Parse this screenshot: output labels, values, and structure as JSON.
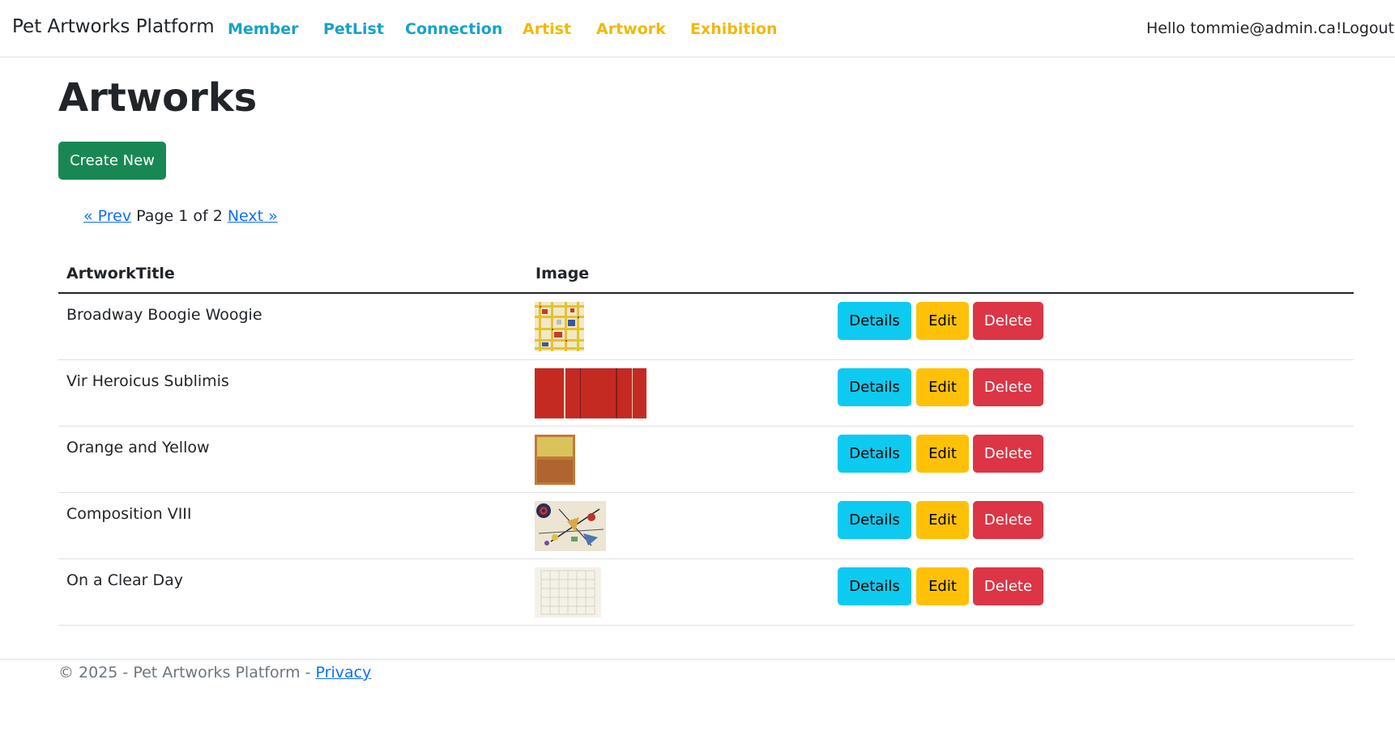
{
  "nav": {
    "brand": "Pet Artworks Platform",
    "links": [
      {
        "label": "Member",
        "color": "#17a2c8"
      },
      {
        "label": "PetList",
        "color": "#17a2c8"
      },
      {
        "label": "Connection",
        "color": "#17a2c8"
      },
      {
        "label": "Artist",
        "color": "#f0b90b"
      },
      {
        "label": "Artwork",
        "color": "#f0b90b"
      },
      {
        "label": "Exhibition",
        "color": "#f0b90b"
      }
    ],
    "greeting": "Hello tommie@admin.ca!",
    "logout": "Logout"
  },
  "page": {
    "title": "Artworks",
    "create_label": "Create New"
  },
  "pager": {
    "prev": "« Prev",
    "status": "Page 1 of 2",
    "next": "Next »"
  },
  "table": {
    "headers": [
      "ArtworkTitle",
      "Image"
    ],
    "rows": [
      {
        "title": "Broadway Boogie Woogie",
        "image": "broadway-boogie-woogie-thumbnail"
      },
      {
        "title": "Vir Heroicus Sublimis",
        "image": "vir-heroicus-sublimis-thumbnail"
      },
      {
        "title": "Orange and Yellow",
        "image": "orange-and-yellow-thumbnail"
      },
      {
        "title": "Composition VIII",
        "image": "composition-viii-thumbnail"
      },
      {
        "title": "On a Clear Day",
        "image": "on-a-clear-day-thumbnail"
      }
    ],
    "actions": {
      "details": "Details",
      "edit": "Edit",
      "delete": "Delete"
    }
  },
  "footer": {
    "text": "© 2025 - Pet Artworks Platform - ",
    "privacy": "Privacy"
  },
  "colors": {
    "create": "#198754",
    "details": "#0dcaf0",
    "edit": "#ffc107",
    "delete": "#dc3545",
    "link": "#0d6efd"
  }
}
